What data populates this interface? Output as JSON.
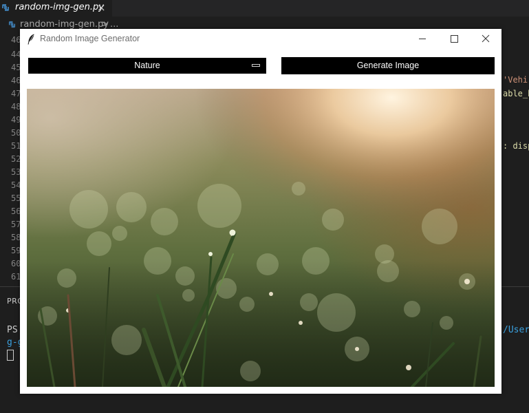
{
  "editor": {
    "tab": {
      "filename": "random-img-gen.py",
      "close_glyph": "×"
    },
    "breadcrumb": {
      "file": "random-img-gen.py",
      "separator": ">",
      "more": "..."
    },
    "line_numbers": [
      "46",
      "44",
      "45",
      "46",
      "47",
      "48",
      "49",
      "50",
      "51",
      "52",
      "53",
      "54",
      "55",
      "56",
      "57",
      "58",
      "59",
      "60",
      "61"
    ],
    "code_fragments": [
      {
        "text": "'Vehi",
        "color": "#ce9178"
      },
      {
        "text": "able_b",
        "color": "#dcdcaa"
      },
      {
        "text": ": disp",
        "color": "#dcdcaa"
      }
    ],
    "panel_tab": "PROBLEMS",
    "terminal": {
      "prompt": "PS",
      "path_fragment": "/User/",
      "continuation": "g-g"
    }
  },
  "app": {
    "title": "Random Image Generator",
    "icon": "feather-icon",
    "controls": {
      "minimize": "minimize-icon",
      "maximize": "maximize-icon",
      "close": "close-icon"
    },
    "category_select": {
      "selected": "Nature",
      "indicator": "option-menu-indicator-icon"
    },
    "generate_button": {
      "label": "Generate Image"
    },
    "image": {
      "subject": "sunlit grass with dew drops"
    }
  },
  "colors": {
    "editor_bg": "#1e1e1e",
    "button_bg": "#000000",
    "button_text": "#ffffff",
    "window_bg": "#ffffff",
    "python_icon": "#3c78aa"
  }
}
